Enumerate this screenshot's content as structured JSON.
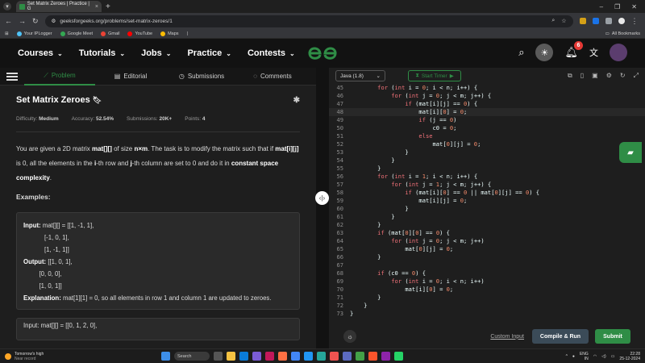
{
  "browser": {
    "tab_title": "Set Matrix Zeroes | Practice | G",
    "url": "geeksforgeeks.org/problems/set-matrix-zeroes/1",
    "bookmarks": [
      "Your IPLogger",
      "Google Meet",
      "Gmail",
      "YouTube",
      "Maps",
      "|"
    ],
    "all_bookmarks": "All Bookmarks"
  },
  "nav": {
    "items": [
      "Courses",
      "Tutorials",
      "Jobs",
      "Practice",
      "Contests"
    ],
    "notification_count": "6"
  },
  "left_tabs": [
    "Problem",
    "Editorial",
    "Submissions",
    "Comments"
  ],
  "problem": {
    "title": "Set Matrix Zeroes",
    "difficulty_label": "Difficulty:",
    "difficulty": "Medium",
    "accuracy_label": "Accuracy:",
    "accuracy": "52.54%",
    "submissions_label": "Submissions:",
    "submissions": "20K+",
    "points_label": "Points:",
    "points": "4",
    "desc_1": "You are given a 2D matrix ",
    "desc_mat": "mat[][]",
    "desc_2": " of size ",
    "desc_nm": "n×m",
    "desc_3": ". The task is to modify the matrix such that if ",
    "desc_mij": "mat[i][j]",
    "desc_4": " is 0, all the elements in the ",
    "desc_i": "i",
    "desc_5": "-th row and ",
    "desc_j": "j",
    "desc_6": "-th column are set to 0 and do it in ",
    "desc_csc": "constant space complexity",
    "desc_7": ".",
    "examples_heading": "Examples:",
    "example1": {
      "input_label": "Input:",
      "input": " mat[][] = [[1, -1, 1],\n            [-1, 0, 1],\n            [1, -1, 1]]",
      "output_label": "Output:",
      "output": " [[1, 0, 1],\n         [0, 0, 0],\n         [1, 0, 1]]",
      "explanation_label": "Explanation:",
      "explanation": " mat[1][1] = 0, so all elements in row 1 and column 1 are updated to zeroes."
    },
    "example2": {
      "input_label": "Input:",
      "input": " mat[][] = [[0, 1, 2, 0],"
    }
  },
  "editor": {
    "language": "Java (1.8)",
    "timer_label": "Start Timer",
    "custom_input": "Custom Input",
    "compile_label": "Compile & Run",
    "submit_label": "Submit",
    "lines": [
      {
        "n": "45",
        "code": "        for (int i = 0; i < n; i++) {"
      },
      {
        "n": "46",
        "code": "            for (int j = 0; j < m; j++) {"
      },
      {
        "n": "47",
        "code": "                if (mat[i][j] == 0) {"
      },
      {
        "n": "48",
        "code": "                    mat[i][0] = 0;"
      },
      {
        "n": "49",
        "code": "                    if (j == 0)"
      },
      {
        "n": "50",
        "code": "                        c0 = 0;"
      },
      {
        "n": "51",
        "code": "                    else"
      },
      {
        "n": "52",
        "code": "                        mat[0][j] = 0;"
      },
      {
        "n": "53",
        "code": "                }"
      },
      {
        "n": "54",
        "code": "            }"
      },
      {
        "n": "55",
        "code": "        }"
      },
      {
        "n": "56",
        "code": "        for (int i = 1; i < n; i++) {"
      },
      {
        "n": "57",
        "code": "            for (int j = 1; j < m; j++) {"
      },
      {
        "n": "58",
        "code": "                if (mat[i][0] == 0 || mat[0][j] == 0) {"
      },
      {
        "n": "59",
        "code": "                    mat[i][j] = 0;"
      },
      {
        "n": "60",
        "code": "                }"
      },
      {
        "n": "61",
        "code": "            }"
      },
      {
        "n": "62",
        "code": "        }"
      },
      {
        "n": "63",
        "code": "        if (mat[0][0] == 0) {"
      },
      {
        "n": "64",
        "code": "            for (int j = 0; j < m; j++)"
      },
      {
        "n": "65",
        "code": "                mat[0][j] = 0;"
      },
      {
        "n": "66",
        "code": "        }"
      },
      {
        "n": "67",
        "code": ""
      },
      {
        "n": "68",
        "code": "        if (c0 == 0) {"
      },
      {
        "n": "69",
        "code": "            for (int i = 0; i < n; i++)"
      },
      {
        "n": "70",
        "code": "                mat[i][0] = 0;"
      },
      {
        "n": "71",
        "code": "        }"
      },
      {
        "n": "72",
        "code": "    }"
      },
      {
        "n": "73",
        "code": "}"
      }
    ]
  },
  "taskbar": {
    "weather_title": "Tomorrow's high",
    "weather_sub": "Near record",
    "search_label": "Search",
    "lang": "ENG",
    "region": "IN",
    "time": "22:28",
    "date": "25-12-2024"
  },
  "colors": {
    "accent": "#2f8d46",
    "badge": "#e53935",
    "compile_bg": "#3b4b58",
    "keyword": "#f07178",
    "number": "#f78c6c"
  }
}
